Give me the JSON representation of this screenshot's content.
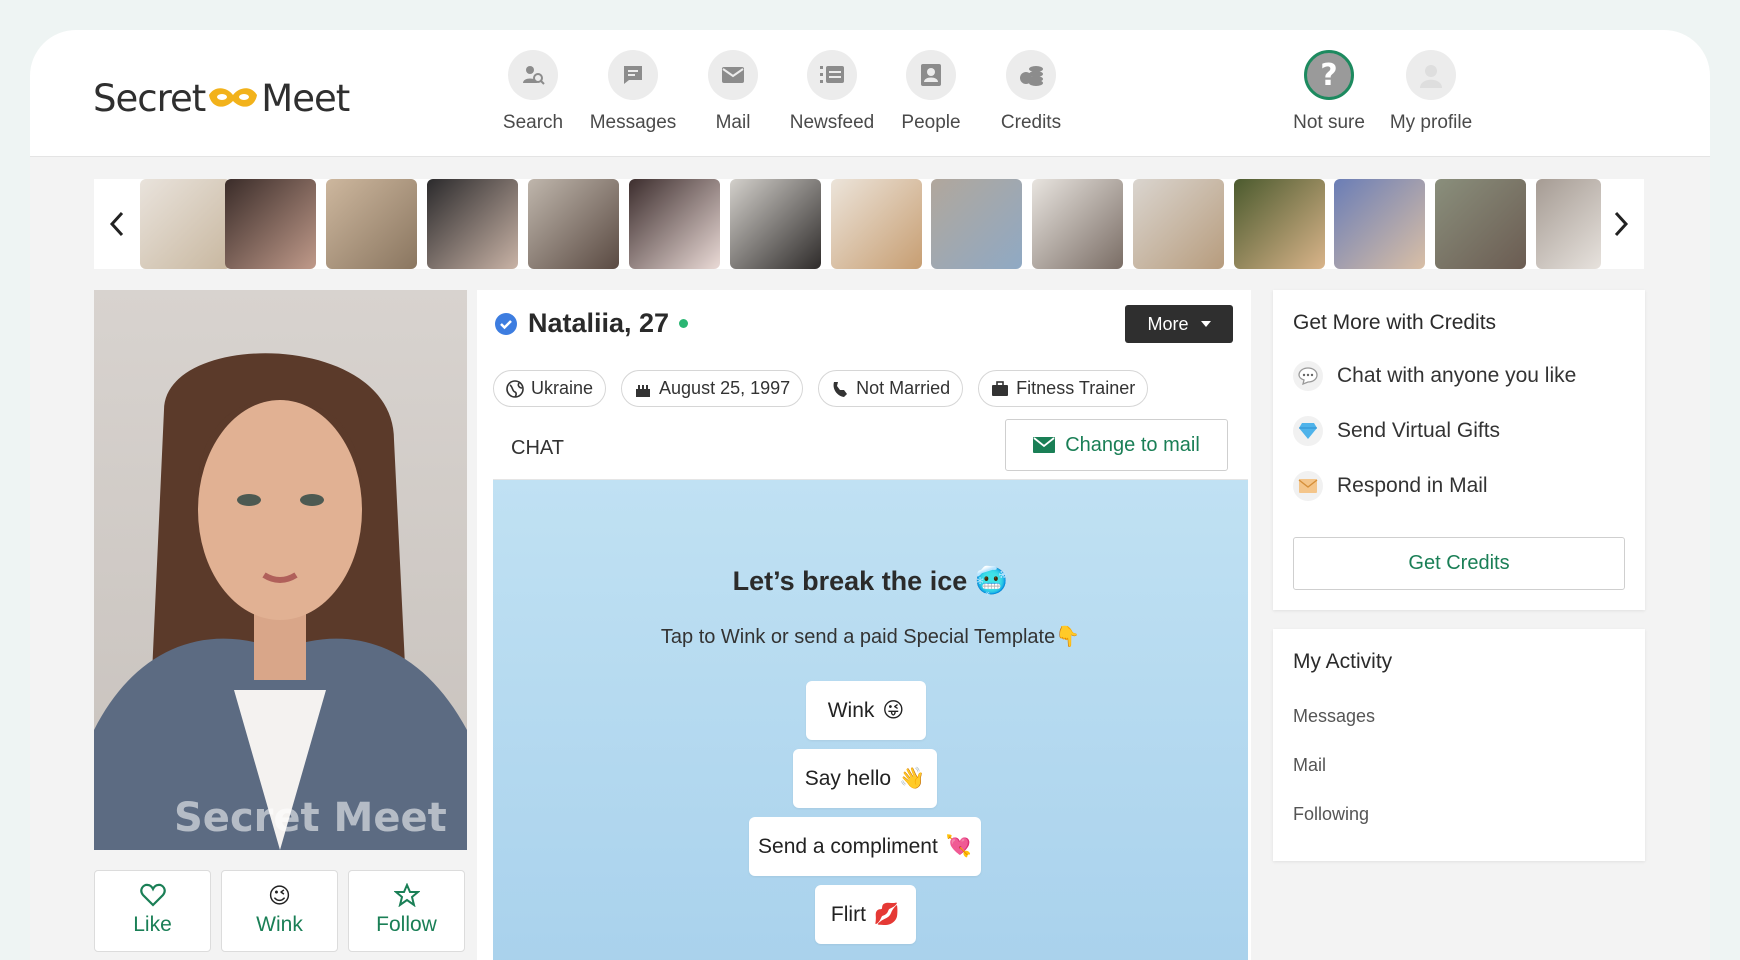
{
  "brand": {
    "logo_left": "Secret",
    "logo_right": "Meet",
    "accent": "#1a7f56",
    "mask_color": "#f2b21b"
  },
  "nav": {
    "items": [
      {
        "label": "Search",
        "icon": "search-user-icon"
      },
      {
        "label": "Messages",
        "icon": "chat-bubble-icon"
      },
      {
        "label": "Mail",
        "icon": "envelope-icon"
      },
      {
        "label": "Newsfeed",
        "icon": "newsfeed-icon"
      },
      {
        "label": "People",
        "icon": "contact-card-icon"
      },
      {
        "label": "Credits",
        "icon": "coins-icon"
      }
    ],
    "not_sure": "Not sure",
    "my_profile": "My profile"
  },
  "carousel": {
    "prev_icon": "chevron-left-icon",
    "next_icon": "chevron-right-icon"
  },
  "profile": {
    "name": "Nataliia, 27",
    "verified_icon": "verified-badge-icon",
    "online": true,
    "more_label": "More",
    "tags": [
      {
        "icon": "globe-icon",
        "text": "Ukraine"
      },
      {
        "icon": "birthday-cake-icon",
        "text": "August 25, 1997"
      },
      {
        "icon": "rings-icon",
        "text": "Not Married"
      },
      {
        "icon": "briefcase-icon",
        "text": "Fitness Trainer"
      }
    ],
    "photo_watermark": "Secret Meet"
  },
  "actions": {
    "like": "Like",
    "wink": "Wink",
    "follow": "Follow"
  },
  "chat": {
    "title": "CHAT",
    "change_btn": "Change to mail",
    "ice_title": "Let’s break the ice 🥶",
    "ice_sub": "Tap to Wink or send a paid Special Template👇",
    "buttons": [
      {
        "label": "Wink",
        "emoji": "😜"
      },
      {
        "label": "Say hello",
        "emoji": "👋"
      },
      {
        "label": "Send a compliment",
        "emoji": "💘"
      },
      {
        "label": "Flirt",
        "emoji": "💋"
      }
    ]
  },
  "credits_card": {
    "title": "Get More with Credits",
    "perks": [
      {
        "icon": "chat-dots-icon",
        "text": "Chat with anyone you like"
      },
      {
        "icon": "diamond-icon",
        "text": "Send Virtual Gifts"
      },
      {
        "icon": "envelope-icon",
        "text": "Respond in Mail"
      }
    ],
    "button": "Get Credits"
  },
  "activity_card": {
    "title": "My Activity",
    "links": [
      "Messages",
      "Mail",
      "Following"
    ]
  }
}
